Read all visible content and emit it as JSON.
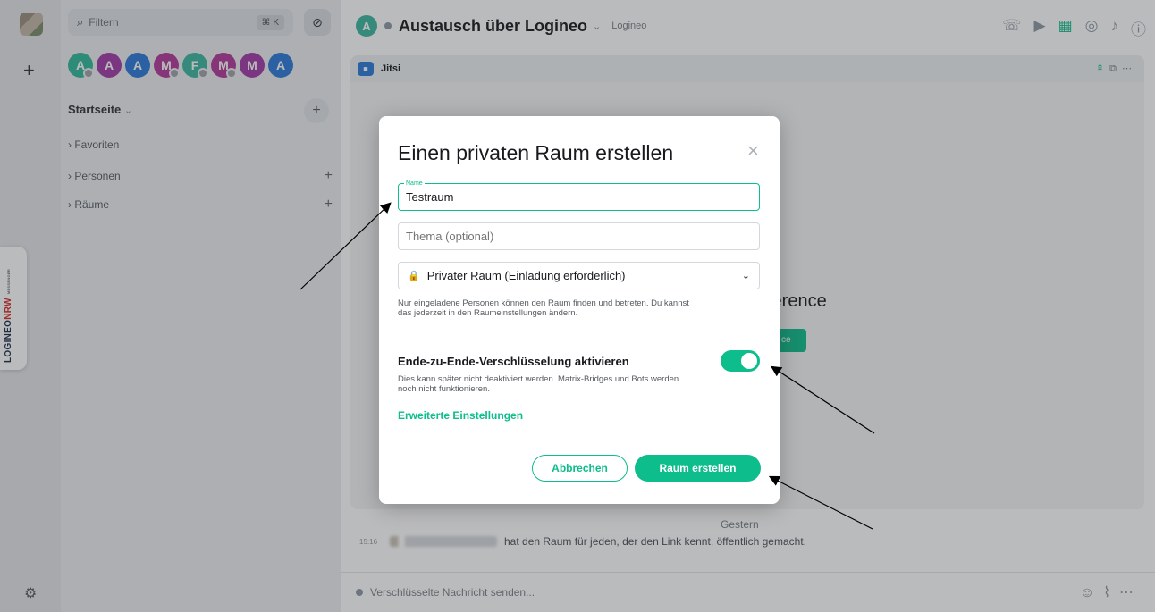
{
  "spaces": {
    "add_label": "+",
    "settings_icon": "gear-icon"
  },
  "logineo": {
    "brand": "LOGINEO",
    "nrw": "NRW",
    "sub": "MESSENGER"
  },
  "roomlist": {
    "filter_placeholder": "Filtern",
    "filter_shortcut": "⌘ K",
    "avatars": [
      {
        "letter": "A",
        "color": "#2fb89a",
        "dot": true
      },
      {
        "letter": "A",
        "color": "#a23aa7",
        "dot": false
      },
      {
        "letter": "A",
        "color": "#2a7ad8",
        "dot": false
      },
      {
        "letter": "M",
        "color": "#b2399a",
        "dot": true
      },
      {
        "letter": "F",
        "color": "#3bb7a0",
        "dot": true
      },
      {
        "letter": "M",
        "color": "#b2399a",
        "dot": true
      },
      {
        "letter": "M",
        "color": "#a23aa7",
        "dot": false
      },
      {
        "letter": "A",
        "color": "#2a7ad8",
        "dot": false
      }
    ],
    "section_title": "Startseite",
    "section_chevron": "⌄",
    "categories": [
      {
        "label": "› Favoriten",
        "plus": ""
      },
      {
        "label": "› Personen",
        "plus": "+"
      },
      {
        "label": "› Räume",
        "plus": "+"
      }
    ]
  },
  "room": {
    "avatar_letter": "A",
    "name": "Austausch über Logineo",
    "chevron": "⌄",
    "topic": "Logineo"
  },
  "widget": {
    "title": "Jitsi",
    "conference_text": "ference",
    "conference_button": "ce"
  },
  "timeline": {
    "date_separator": "Gestern",
    "event_time": "15:16",
    "event_text": "hat den Raum für jeden, der den Link kennt, öffentlich gemacht."
  },
  "composer": {
    "placeholder": "Verschlüsselte Nachricht senden..."
  },
  "dialog": {
    "title": "Einen privaten Raum erstellen",
    "name_label": "Name",
    "name_value": "Testraum",
    "topic_placeholder": "Thema (optional)",
    "visibility_selected": "Privater Raum (Einladung erforderlich)",
    "visibility_help": "Nur eingeladene Personen können den Raum finden und betreten. Du kannst das jederzeit in den Raumeinstellungen ändern.",
    "e2e_title": "Ende-zu-Ende-Verschlüsselung aktivieren",
    "e2e_enabled": true,
    "e2e_help": "Dies kann später nicht deaktiviert werden. Matrix-Bridges und Bots werden noch nicht funktionieren.",
    "advanced_label": "Erweiterte Einstellungen",
    "cancel_label": "Abbrechen",
    "create_label": "Raum erstellen"
  },
  "colors": {
    "accent": "#0dbd8b",
    "muted_icon": "#8d97a5"
  }
}
